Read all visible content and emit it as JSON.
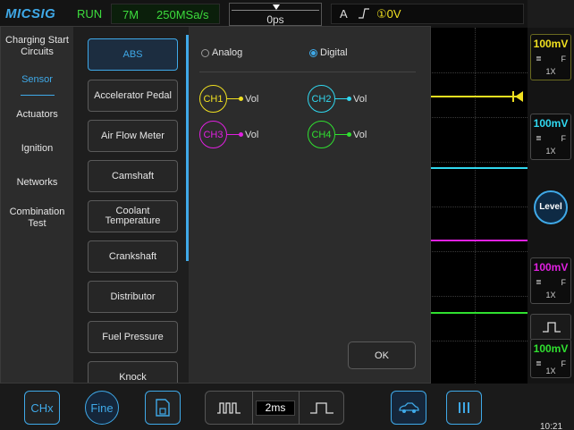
{
  "topbar": {
    "logo": "MICSIG",
    "run_state": "RUN",
    "memory_depth": "7M",
    "sample_rate": "250MSa/s",
    "time_offset": "0ps",
    "trigger_source": "A",
    "trigger_level": "0V",
    "trigger_channel_glyph": "①"
  },
  "channels": [
    {
      "id": "CH1",
      "volts": "100mV",
      "coupling": "F",
      "probe": "1X",
      "color": "#f0e020"
    },
    {
      "id": "CH2",
      "volts": "100mV",
      "coupling": "F",
      "probe": "1X",
      "color": "#30d8f0"
    },
    {
      "id": "CH3",
      "volts": "100mV",
      "coupling": "F",
      "probe": "1X",
      "color": "#e020e0"
    },
    {
      "id": "CH4",
      "volts": "100mV",
      "coupling": "F",
      "probe": "1X",
      "color": "#30e030"
    }
  ],
  "rightcol": {
    "level_label": "Level",
    "bars_glyph": "≣"
  },
  "bottombar": {
    "chx_label": "CHx",
    "fine_label": "Fine",
    "timebase": "2ms",
    "clock": "10:21"
  },
  "modal": {
    "categories": [
      {
        "label": "Charging Start Circuits",
        "active": false
      },
      {
        "label": "Sensor",
        "active": true
      },
      {
        "label": "Actuators",
        "active": false
      },
      {
        "label": "Ignition",
        "active": false
      },
      {
        "label": "Networks",
        "active": false
      },
      {
        "label": "Combination Test",
        "active": false
      }
    ],
    "sensors": [
      {
        "label": "ABS",
        "active": true
      },
      {
        "label": "Accelerator Pedal",
        "active": false
      },
      {
        "label": "Air Flow Meter",
        "active": false
      },
      {
        "label": "Camshaft",
        "active": false
      },
      {
        "label": "Coolant Temperature",
        "active": false
      },
      {
        "label": "Crankshaft",
        "active": false
      },
      {
        "label": "Distributor",
        "active": false
      },
      {
        "label": "Fuel Pressure",
        "active": false
      },
      {
        "label": "Knock",
        "active": false
      }
    ],
    "mode": {
      "analog_label": "Analog",
      "digital_label": "Digital",
      "selected": "Digital"
    },
    "channel_map": [
      {
        "channel": "CH1",
        "signal": "Vol"
      },
      {
        "channel": "CH2",
        "signal": "Vol"
      },
      {
        "channel": "CH3",
        "signal": "Vol"
      },
      {
        "channel": "CH4",
        "signal": "Vol"
      }
    ],
    "ok_label": "OK"
  }
}
